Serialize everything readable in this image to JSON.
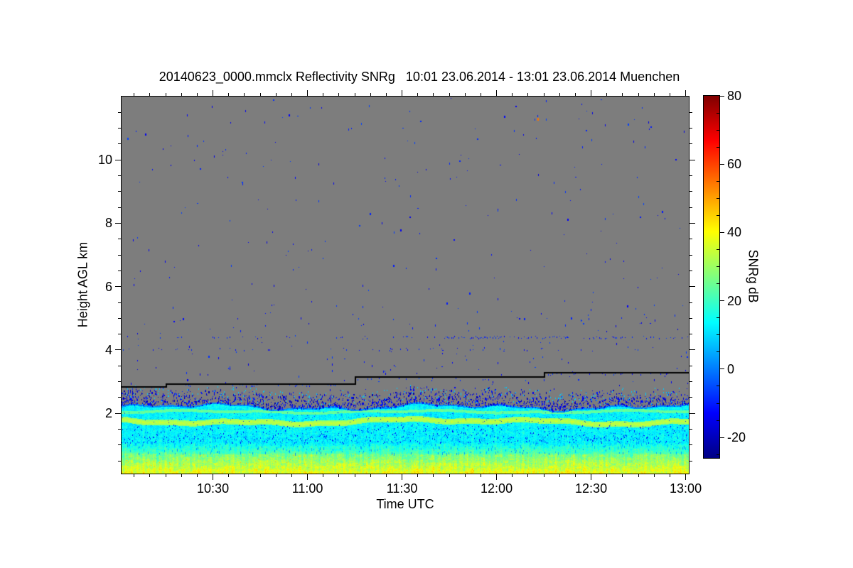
{
  "chart_data": {
    "type": "heatmap",
    "title": "20140623_0000.mmclx Reflectivity SNRg   10:01 23.06.2014 - 13:01 23.06.2014 Muenchen",
    "file": "20140623_0000.mmclx",
    "quantity": "Reflectivity SNRg",
    "time_start": "10:01 23.06.2014",
    "time_end": "13:01 23.06.2014",
    "station": "Muenchen",
    "x_axis": {
      "label": "Time UTC",
      "start_min": 601,
      "end_min": 781,
      "major_ticks": [
        {
          "label": "10:30",
          "min": 630
        },
        {
          "label": "11:00",
          "min": 660
        },
        {
          "label": "11:30",
          "min": 690
        },
        {
          "label": "12:00",
          "min": 720
        },
        {
          "label": "12:30",
          "min": 750
        },
        {
          "label": "13:00",
          "min": 780
        }
      ],
      "minor_tick_interval_min": 5
    },
    "y_axis": {
      "label": "Height AGL km",
      "min": 0.1,
      "max": 12.0,
      "major_ticks": [
        2,
        4,
        6,
        8,
        10
      ],
      "minor_tick_interval_km": 0.5
    },
    "colorbar": {
      "label": "SNRg dB",
      "min": -26,
      "max": 80,
      "major_ticks": [
        80,
        60,
        40,
        20,
        0,
        -20
      ],
      "minor_tick_interval_db": 5,
      "colormap": "jet",
      "gradient_stops": [
        {
          "v": 0.0,
          "color": "#000083"
        },
        {
          "v": 0.125,
          "color": "#0000ff"
        },
        {
          "v": 0.375,
          "color": "#00ffff"
        },
        {
          "v": 0.625,
          "color": "#ffff00"
        },
        {
          "v": 0.875,
          "color": "#ff0000"
        },
        {
          "v": 1.0,
          "color": "#800000"
        }
      ]
    },
    "no_signal_color": "#7d7d7d",
    "black_line_segments": [
      {
        "t0_min": 601,
        "t1_min": 615,
        "km": 2.85
      },
      {
        "t0_min": 615,
        "t1_min": 675,
        "km": 2.95
      },
      {
        "t0_min": 675,
        "t1_min": 735,
        "km": 3.16
      },
      {
        "t0_min": 735,
        "t1_min": 781,
        "km": 3.3
      }
    ],
    "boundary_layer": {
      "echo_top_km": 2.25,
      "layers": [
        {
          "height_km": [
            2.0,
            2.3
          ],
          "snr_db": 5,
          "desc": "ragged echo top, cyan with dense blue speckles above"
        },
        {
          "height_km": [
            1.98,
            2.1
          ],
          "snr_db": 24,
          "desc": "faint pale-green thin line"
        },
        {
          "height_km": [
            1.65,
            1.85
          ],
          "snr_db": 32,
          "desc": "bright wavy light-green band"
        },
        {
          "height_km": [
            1.05,
            1.65
          ],
          "snr_db": 13,
          "desc": "cyan with blue vertical speckles"
        },
        {
          "height_km": [
            0.7,
            1.05
          ],
          "snr_db": 18,
          "desc": "cyan to green transition"
        },
        {
          "height_km": [
            0.1,
            0.7
          ],
          "snr_db": 32,
          "desc": "green-yellow mottle, yellowest near surface ~40 dB"
        }
      ]
    },
    "speckle_lines": [
      {
        "km": 4.42,
        "desc": "dotted blue speckle line, denser right of ~11:40"
      },
      {
        "km": 4.05,
        "desc": "sparse dotted blue speckle line"
      }
    ],
    "isolated_echo": {
      "time": "12:12",
      "km": 11.3,
      "snr_db": 55,
      "desc": "orange speck with blue dot above"
    },
    "noise_speckles": {
      "color_db_range": [
        -22,
        -6
      ],
      "desc": "sparse blue dashes scattered over gray no-signal area"
    }
  }
}
